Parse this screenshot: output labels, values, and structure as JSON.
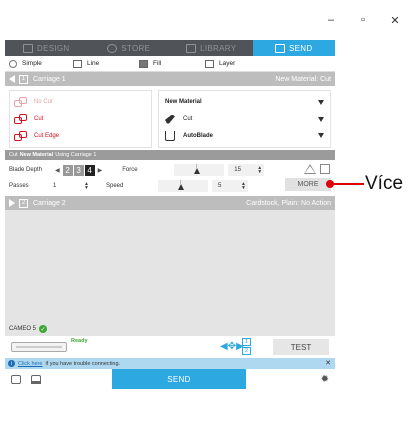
{
  "window": {
    "controls": [
      "–",
      "▫",
      "✕"
    ]
  },
  "nav": {
    "tabs": [
      {
        "label": "DESIGN",
        "icon": "design-icon"
      },
      {
        "label": "STORE",
        "icon": "store-icon"
      },
      {
        "label": "LIBRARY",
        "icon": "library-icon"
      },
      {
        "label": "SEND",
        "icon": "send-icon",
        "active": true
      }
    ],
    "active_color": "#2da8e0",
    "bar_color": "#505358"
  },
  "modes": [
    "Simple",
    "Line",
    "Fill",
    "Layer"
  ],
  "carriage1": {
    "number": "1",
    "label": "Carriage 1",
    "material_summary": "New Material: Cut"
  },
  "cut_types": [
    "No Cut",
    "Cut",
    "Cut Edge"
  ],
  "material": {
    "name": "New Material",
    "action": "Cut",
    "tool": "AutoBlade"
  },
  "settings_header": {
    "prefix": "Cut",
    "material": "New Material",
    "suffix": "Using Carriage 1"
  },
  "settings": {
    "blade_depth_label": "Blade Depth",
    "blade_depth_digits": [
      "2",
      "3",
      "4"
    ],
    "passes_label": "Passes",
    "passes_value": "1",
    "force_label": "Force",
    "force_value": "15",
    "speed_label": "Speed",
    "speed_value": "5",
    "more_label": "MORE"
  },
  "carriage2": {
    "number": "2",
    "label": "Carriage 2",
    "material_summary": "Cardstock, Plain: No Action"
  },
  "status": {
    "device": "CAMEO 5",
    "ready": "Ready"
  },
  "carriage_select": [
    "1",
    "2"
  ],
  "test_label": "TEST",
  "info": {
    "link": "Click here",
    "text": "if you have trouble connecting."
  },
  "send_label": "SEND",
  "callout": {
    "label": "Více",
    "color": "#dd0000"
  }
}
